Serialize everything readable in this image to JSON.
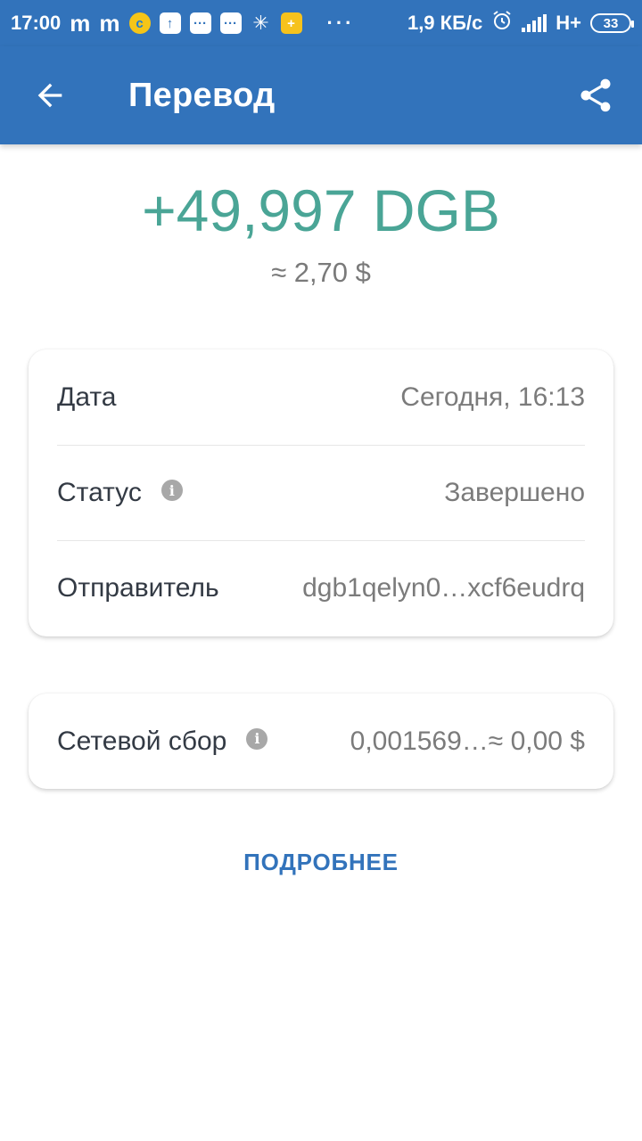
{
  "status_bar": {
    "time": "17:00",
    "notif_m1": "m",
    "notif_m2": "m",
    "more_dots": "···",
    "net_speed": "1,9 КБ/с",
    "network_type": "H+",
    "battery_level": "33"
  },
  "app_bar": {
    "title": "Перевод",
    "back_icon": "arrow-back-icon",
    "share_icon": "share-icon"
  },
  "amount": {
    "crypto": "+49,997 DGB",
    "fiat": "≈ 2,70 $"
  },
  "details": {
    "rows": [
      {
        "label": "Дата",
        "value": "Сегодня, 16:13"
      },
      {
        "label": "Статус",
        "value": "Завершено"
      },
      {
        "label": "Отправитель",
        "value": "dgb1qelyn0…xcf6eudrq"
      }
    ]
  },
  "fee": {
    "label": "Сетевой сбор",
    "value": "0,001569…≈ 0,00 $"
  },
  "more_link": "ПОДРОБНЕЕ",
  "colors": {
    "primary": "#3273bb",
    "amount_green": "#4aa596",
    "secondary_text": "#7b7b7b",
    "label_text": "#333a44"
  }
}
